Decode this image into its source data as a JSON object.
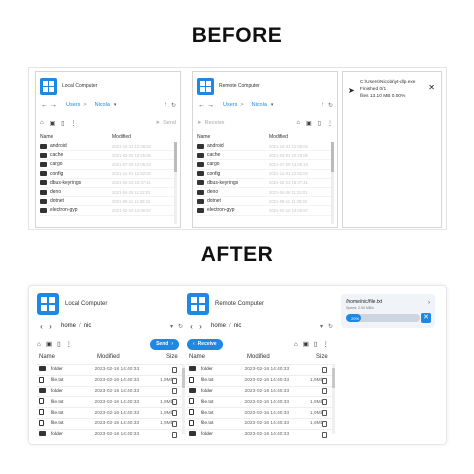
{
  "headings": {
    "before": "BEFORE",
    "after": "AFTER"
  },
  "accent_color": "#1e88e5",
  "before": {
    "local": {
      "title": "Local Computer",
      "crumbs": [
        "Users",
        "Nicola"
      ],
      "send_label": "Send",
      "columns": {
        "name": "Name",
        "modified": "Modified"
      },
      "rows": [
        {
          "name": "android",
          "date": "2021-10-31 12:08:02"
        },
        {
          "name": "cache",
          "date": "2021-03-02 10:25:06"
        },
        {
          "name": "cargo",
          "date": "2021-07-29 13:05:24"
        },
        {
          "name": "config",
          "date": "2021-12-01 12:52:02"
        },
        {
          "name": "dbus-keyrings",
          "date": "2021-02-23 18:37:41"
        },
        {
          "name": "deno",
          "date": "2021-04-28 11:22:01"
        },
        {
          "name": "dotnet",
          "date": "2021-09-11 11:38:22"
        },
        {
          "name": "electron-gyp",
          "date": "2021-02-10 14:06:57"
        }
      ]
    },
    "remote": {
      "title": "Remote Computer",
      "crumbs": [
        "Users",
        "Nicola"
      ],
      "receive_label": "Receive",
      "columns": {
        "name": "Name",
        "modified": "Modified"
      },
      "rows": [
        {
          "name": "android",
          "date": "2021-10-31 12:08:02"
        },
        {
          "name": "cache",
          "date": "2021-03-02 10:25:06"
        },
        {
          "name": "cargo",
          "date": "2021-07-29 13:05:24"
        },
        {
          "name": "config",
          "date": "2021-12-01 12:52:02"
        },
        {
          "name": "dbus-keyrings",
          "date": "2021-02-23 18:37:41"
        },
        {
          "name": "deno",
          "date": "2021-04-28 11:22:01"
        },
        {
          "name": "dotnet",
          "date": "2021-09-11 11:38:22"
        },
        {
          "name": "electron-gyp",
          "date": "2021-02-10 14:06:57"
        }
      ]
    },
    "transfer": {
      "path": "C:\\Users\\Nicola\\yt-dlp.exe",
      "status": "Finished 0/1",
      "detail": "files 13.10 MB 0.00%"
    }
  },
  "after": {
    "local": {
      "title": "Local Computer",
      "crumbs": [
        "home",
        "nic"
      ],
      "send_label": "Send",
      "columns": {
        "name": "Name",
        "modified": "Modified",
        "size": "Size"
      },
      "rows": [
        {
          "type": "folder",
          "name": "folder",
          "date": "2023-02-16 14:40:33",
          "size": ""
        },
        {
          "type": "file",
          "name": "file.txt",
          "date": "2023-02-16 14:40:33",
          "size": "1,9Mb"
        },
        {
          "type": "folder",
          "name": "folder",
          "date": "2023-02-16 14:40:33",
          "size": ""
        },
        {
          "type": "file",
          "name": "file.txt",
          "date": "2023-02-16 14:40:33",
          "size": "1,9Mb"
        },
        {
          "type": "file",
          "name": "file.txt",
          "date": "2023-02-16 14:40:33",
          "size": "1,9Mb"
        },
        {
          "type": "file",
          "name": "file.txt",
          "date": "2023-02-16 14:40:33",
          "size": "1,9Mb"
        },
        {
          "type": "folder",
          "name": "folder",
          "date": "2023-02-16 14:40:33",
          "size": ""
        }
      ]
    },
    "remote": {
      "title": "Remote Computer",
      "crumbs": [
        "home",
        "nic"
      ],
      "receive_label": "Receive",
      "columns": {
        "name": "Name",
        "modified": "Modified",
        "size": "Size"
      },
      "rows": [
        {
          "type": "folder",
          "name": "folder",
          "date": "2023-02-16 14:40:33",
          "size": ""
        },
        {
          "type": "file",
          "name": "file.txt",
          "date": "2023-02-16 14:40:33",
          "size": "1,9Mb"
        },
        {
          "type": "folder",
          "name": "folder",
          "date": "2023-02-16 14:40:33",
          "size": ""
        },
        {
          "type": "file",
          "name": "file.txt",
          "date": "2023-02-16 14:40:33",
          "size": "1,9Mb"
        },
        {
          "type": "file",
          "name": "file.txt",
          "date": "2023-02-16 14:40:33",
          "size": "1,9Mb"
        },
        {
          "type": "file",
          "name": "file.txt",
          "date": "2023-02-16 14:40:33",
          "size": "1,9Mb"
        },
        {
          "type": "folder",
          "name": "folder",
          "date": "2023-02-16 14:40:33",
          "size": ""
        }
      ]
    },
    "transfer": {
      "path": "/home/nic/file.txt",
      "speed": "Speed: 2.90 MB/s",
      "progress_label": "20%",
      "progress": 0.2
    }
  }
}
